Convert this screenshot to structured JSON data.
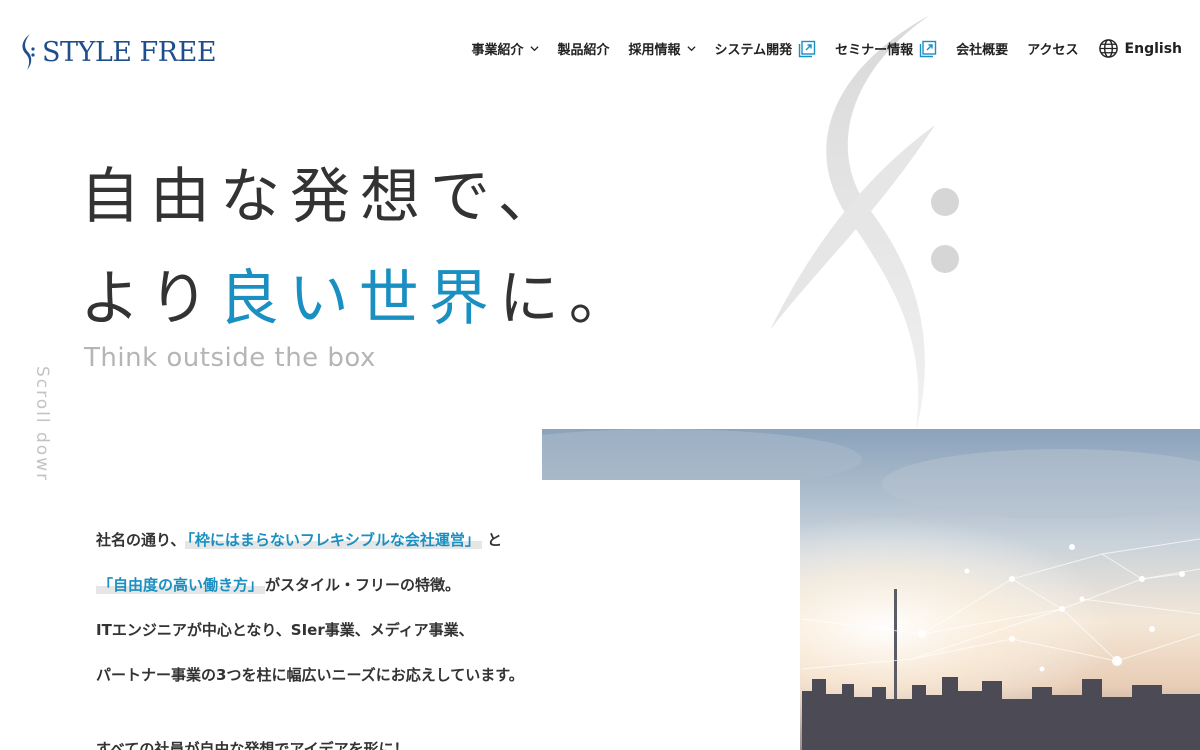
{
  "brand": {
    "logo_text": "STYLE FREE"
  },
  "nav": {
    "items": [
      {
        "label": "事業紹介"
      },
      {
        "label": "製品紹介"
      },
      {
        "label": "採用情報"
      },
      {
        "label": "システム開発"
      },
      {
        "label": "セミナー情報"
      },
      {
        "label": "会社概要"
      },
      {
        "label": "アクセス"
      }
    ],
    "language": "English"
  },
  "hero": {
    "line1": "自由な発想で、",
    "line2_pre": "より",
    "line2_accent": "良い世界",
    "line2_post": "に。",
    "tagline": "Think outside the box",
    "scroll": "Scroll down"
  },
  "intro": {
    "p1_pre": "社名の通り、",
    "p1_hl": "「枠にはまらないフレキシブルな会社運営」",
    "p1_post": " と",
    "p2_hl": "「自由度の高い働き方」",
    "p2_post": "がスタイル・フリーの特徴。",
    "p3": "ITエンジニアが中心となり、SIer事業、メディア事業、",
    "p4": "パートナー事業の3つを柱に幅広いニーズにお応えしています。",
    "p5": "すべての社員が自由な発想でアイデアを形に！"
  },
  "colors": {
    "brand": "#1f4e8c",
    "accent": "#1a8fc1"
  }
}
